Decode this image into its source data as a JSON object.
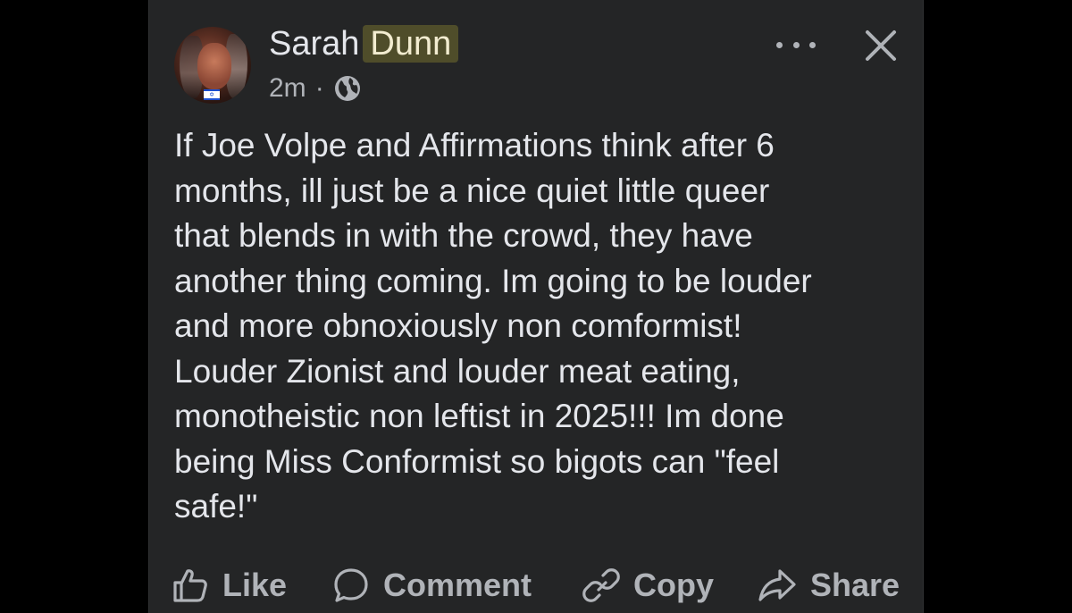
{
  "post": {
    "author_first": "Sarah",
    "author_last": "Dunn",
    "time": "2m",
    "separator": "·",
    "privacy_icon": "globe-icon",
    "body": "If Joe Volpe and Affirmations think after 6\nmonths, ill just be a nice quiet little queer\nthat blends in with the crowd, they have\nanother thing coming. Im going to be louder\nand more obnoxiously non comformist!\nLouder Zionist and louder meat eating,\nmonotheistic non leftist in 2025!!! Im done\nbeing Miss Conformist so bigots can \"feel\nsafe!\""
  },
  "header_actions": {
    "more_icon": "more-options-icon",
    "close_icon": "close-icon"
  },
  "actions": {
    "like": "Like",
    "comment": "Comment",
    "copy": "Copy",
    "share": "Share"
  },
  "colors": {
    "card_bg": "#242526",
    "text_primary": "#e4e6eb",
    "text_secondary": "#b0b3b8",
    "name_highlight": "#4f4d2a"
  }
}
